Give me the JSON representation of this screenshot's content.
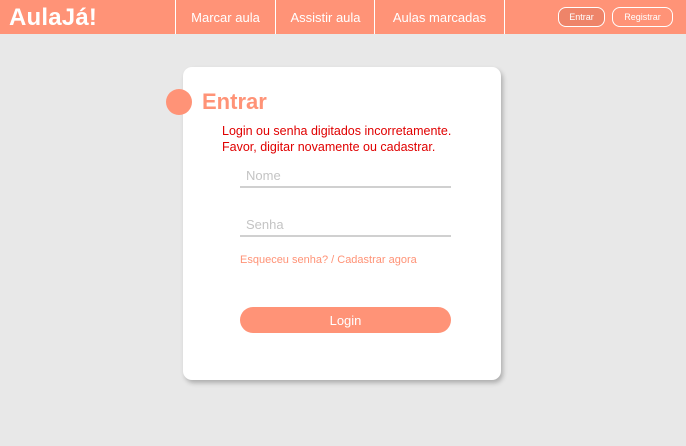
{
  "brand": "AulaJá!",
  "nav": {
    "marcar": "Marcar aula",
    "assistir": "Assistir aula",
    "marcadas": "Aulas marcadas"
  },
  "auth": {
    "entrar": "Entrar",
    "registrar": "Registrar"
  },
  "login": {
    "title": "Entrar",
    "error_line1": "Login ou senha digitados incorretamente.",
    "error_line2": "Favor, digitar novamente ou cadastrar.",
    "nome_placeholder": "Nome",
    "senha_placeholder": "Senha",
    "forgot": "Esqueceu senha?",
    "separator": " / ",
    "register_now": "Cadastrar agora",
    "button": "Login"
  },
  "colors": {
    "accent": "#ff9377",
    "error": "#e00000",
    "background": "#e8e8e8"
  }
}
